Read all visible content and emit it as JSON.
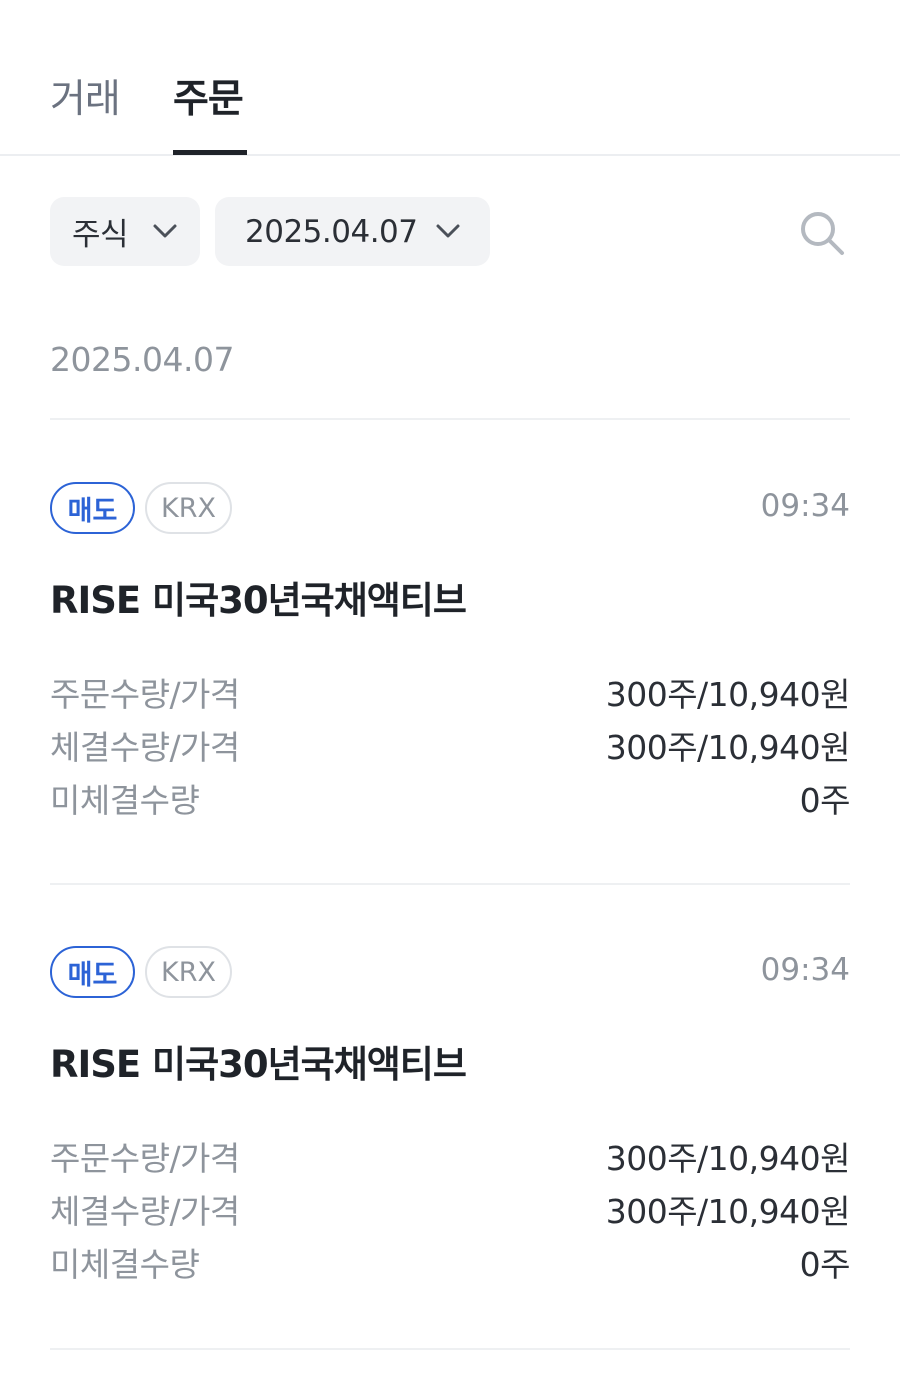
{
  "tabs": [
    {
      "label": "거래",
      "active": false
    },
    {
      "label": "주문",
      "active": true
    }
  ],
  "filters": {
    "type_label": "주식",
    "date_label": "2025.04.07"
  },
  "date_header": "2025.04.07",
  "orders": [
    {
      "side": "매도",
      "market": "KRX",
      "time": "09:34",
      "name": "RISE 미국30년국채액티브",
      "rows": [
        {
          "label": "주문수량/가격",
          "value": "300주/10,940원"
        },
        {
          "label": "체결수량/가격",
          "value": "300주/10,940원"
        },
        {
          "label": "미체결수량",
          "value": "0주"
        }
      ]
    },
    {
      "side": "매도",
      "market": "KRX",
      "time": "09:34",
      "name": "RISE 미국30년국채액티브",
      "rows": [
        {
          "label": "주문수량/가격",
          "value": "300주/10,940원"
        },
        {
          "label": "체결수량/가격",
          "value": "300주/10,940원"
        },
        {
          "label": "미체결수량",
          "value": "0주"
        }
      ]
    }
  ],
  "colors": {
    "accent_sell": "#2c63d6",
    "text_primary": "#1f2329",
    "text_muted": "#8e949c",
    "chip_bg": "#f2f3f5"
  },
  "icons": {
    "chevron": "chevron-down-icon",
    "search": "search-icon"
  }
}
